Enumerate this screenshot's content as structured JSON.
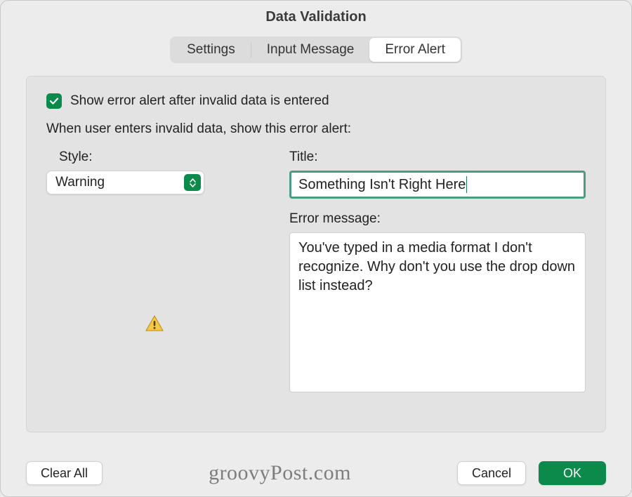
{
  "window": {
    "title": "Data Validation"
  },
  "tabs": {
    "settings": "Settings",
    "input_message": "Input Message",
    "error_alert": "Error Alert",
    "active": "error_alert"
  },
  "checkbox": {
    "checked": true,
    "label": "Show error alert after invalid data is entered"
  },
  "prompt": "When user enters invalid data, show this error alert:",
  "style": {
    "label": "Style:",
    "value": "Warning"
  },
  "title_field": {
    "label": "Title:",
    "value": "Something Isn't Right Here"
  },
  "error_message": {
    "label": "Error message:",
    "value": "You've typed in a media format I don't recognize. Why don't you use the drop down list instead?"
  },
  "icons": {
    "style_preview": "warning-triangle-icon"
  },
  "buttons": {
    "clear_all": "Clear All",
    "cancel": "Cancel",
    "ok": "OK"
  },
  "watermark": "groovyPost.com",
  "colors": {
    "accent": "#0b8a4b",
    "focus_border": "#4a9d7e"
  }
}
